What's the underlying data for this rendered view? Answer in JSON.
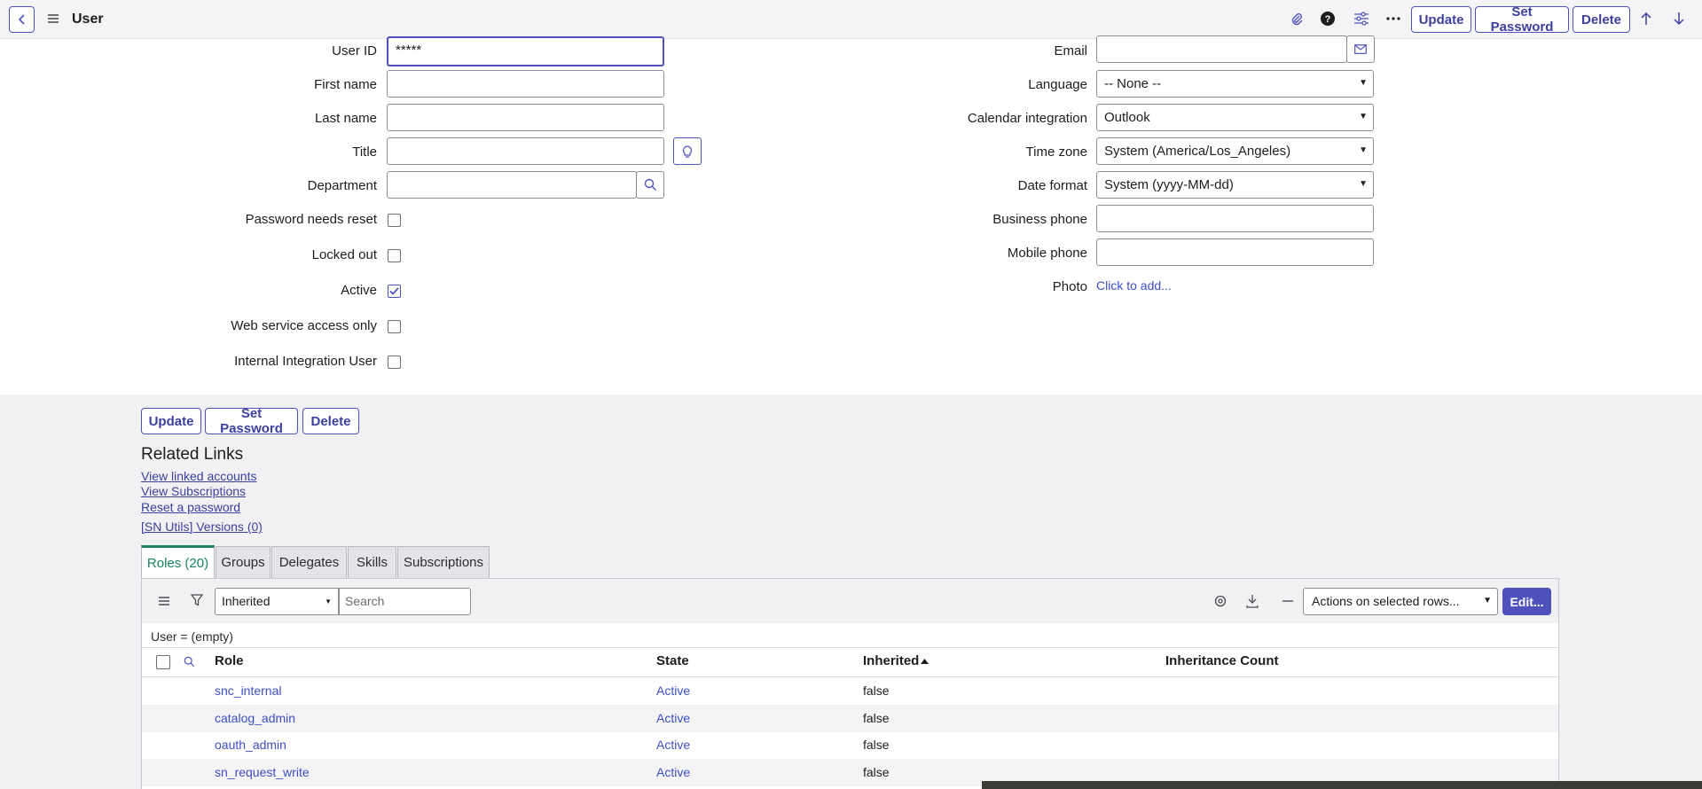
{
  "header": {
    "title": "User",
    "buttons": {
      "update": "Update",
      "set_password": "Set Password",
      "delete": "Delete"
    }
  },
  "form": {
    "left": {
      "user_id": {
        "label": "User ID",
        "value": "*****"
      },
      "first_name": {
        "label": "First name",
        "value": ""
      },
      "last_name": {
        "label": "Last name",
        "value": ""
      },
      "title": {
        "label": "Title",
        "value": ""
      },
      "department": {
        "label": "Department",
        "value": ""
      },
      "password_needs_reset": {
        "label": "Password needs reset",
        "checked": false
      },
      "locked_out": {
        "label": "Locked out",
        "checked": false
      },
      "active": {
        "label": "Active",
        "checked": true
      },
      "web_service_access_only": {
        "label": "Web service access only",
        "checked": false
      },
      "internal_integration_user": {
        "label": "Internal Integration User",
        "checked": false
      }
    },
    "right": {
      "email": {
        "label": "Email",
        "value": ""
      },
      "language": {
        "label": "Language",
        "value": "-- None --"
      },
      "calendar_integration": {
        "label": "Calendar integration",
        "value": "Outlook"
      },
      "time_zone": {
        "label": "Time zone",
        "value": "System (America/Los_Angeles)"
      },
      "date_format": {
        "label": "Date format",
        "value": "System (yyyy-MM-dd)"
      },
      "business_phone": {
        "label": "Business phone",
        "value": ""
      },
      "mobile_phone": {
        "label": "Mobile phone",
        "value": ""
      },
      "photo": {
        "label": "Photo",
        "link": "Click to add..."
      }
    }
  },
  "bottom_buttons": {
    "update": "Update",
    "set_password": "Set Password",
    "delete": "Delete"
  },
  "related_links": {
    "title": "Related Links",
    "links": [
      "View linked accounts",
      "View Subscriptions",
      "Reset a password",
      "[SN Utils] Versions (0)"
    ]
  },
  "tabs": [
    "Roles (20)",
    "Groups",
    "Delegates",
    "Skills",
    "Subscriptions"
  ],
  "list": {
    "filter_field": "Inherited",
    "search_placeholder": "Search",
    "actions_select": "Actions on selected rows...",
    "edit_button": "Edit...",
    "breadcrumb": "User = (empty)",
    "columns": [
      "Role",
      "State",
      "Inherited",
      "Inheritance Count"
    ],
    "sorted_column": "Inherited",
    "rows": [
      {
        "role": "snc_internal",
        "state": "Active",
        "inherited": "false",
        "count": ""
      },
      {
        "role": "catalog_admin",
        "state": "Active",
        "inherited": "false",
        "count": ""
      },
      {
        "role": "oauth_admin",
        "state": "Active",
        "inherited": "false",
        "count": ""
      },
      {
        "role": "sn_request_write",
        "state": "Active",
        "inherited": "false",
        "count": ""
      }
    ]
  },
  "colors": {
    "accent": "#4f52bd",
    "link": "#3c4fc4",
    "tab_active": "#18835e"
  }
}
